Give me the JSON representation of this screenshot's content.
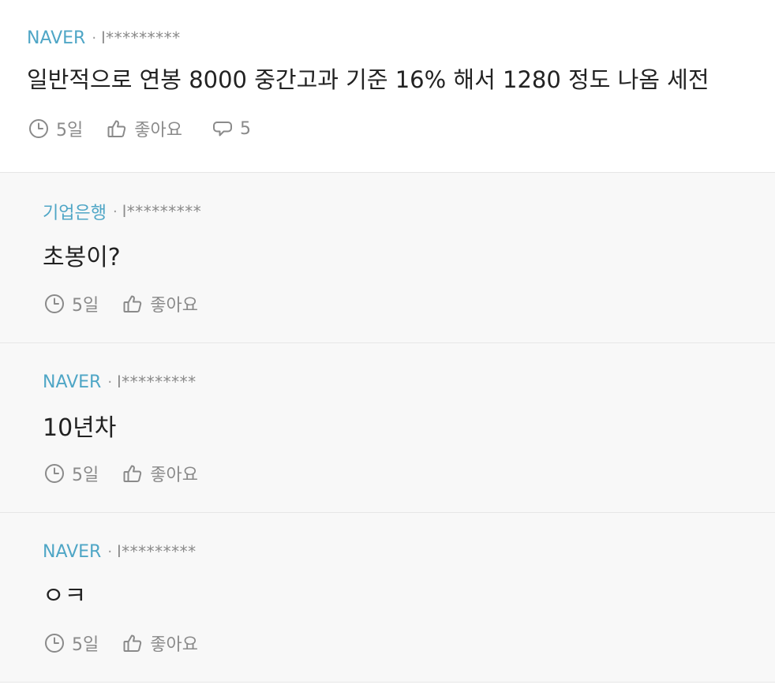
{
  "post": {
    "company": "NAVER",
    "author": "l*********",
    "content": "일반적으로 연봉 8000 중간고과 기준 16% 해서 1280 정도 나옴 세전",
    "time": "5일",
    "like_label": "좋아요",
    "comment_count": "5"
  },
  "replies": [
    {
      "company": "기업은행",
      "author": "l*********",
      "content": "초봉이?",
      "time": "5일",
      "like_label": "좋아요"
    },
    {
      "company": "NAVER",
      "author": "l*********",
      "content": "10년차",
      "time": "5일",
      "like_label": "좋아요"
    },
    {
      "company": "NAVER",
      "author": "l*********",
      "content": "ㅇㅋ",
      "time": "5일",
      "like_label": "좋아요"
    }
  ],
  "separator": "·",
  "icons": {
    "time": "clock-icon",
    "like": "thumbs-up-icon",
    "comment": "comment-icon"
  },
  "colors": {
    "company": "#4fa6c6",
    "meta": "#8a8a8a",
    "reply_bg": "#f8f8f8",
    "divider": "#e6e6e6"
  }
}
